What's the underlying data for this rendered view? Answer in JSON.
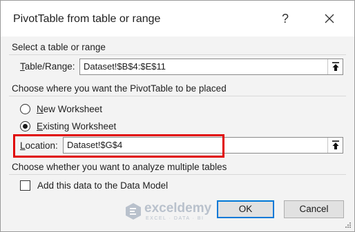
{
  "window": {
    "title": "PivotTable from table or range",
    "help_label": "?",
    "close_icon": "close-icon"
  },
  "source": {
    "heading": "Select a table or range",
    "table_range": {
      "label_underlined": "T",
      "label_rest": "able/Range:",
      "value": "Dataset!$B$4:$E$11"
    }
  },
  "placement": {
    "heading": "Choose where you want the PivotTable to be placed",
    "options": [
      {
        "underlined": "N",
        "rest": "ew Worksheet",
        "selected": false
      },
      {
        "underlined": "E",
        "rest": "xisting Worksheet",
        "selected": true
      }
    ],
    "location": {
      "label_underlined": "L",
      "label_rest": "ocation:",
      "value": "Dataset!$G$4",
      "highlight_color": "#e00000"
    }
  },
  "multiple_tables": {
    "heading": "Choose whether you want to analyze multiple tables",
    "checkbox_label": "Add this data to the Data Model",
    "checked": false
  },
  "buttons": {
    "ok": "OK",
    "cancel": "Cancel"
  },
  "watermark": {
    "name": "exceldemy",
    "tagline": "EXCEL · DATA · BI"
  },
  "colors": {
    "default_button_border": "#0078d7",
    "dialog_background": "#f3f3f3"
  }
}
